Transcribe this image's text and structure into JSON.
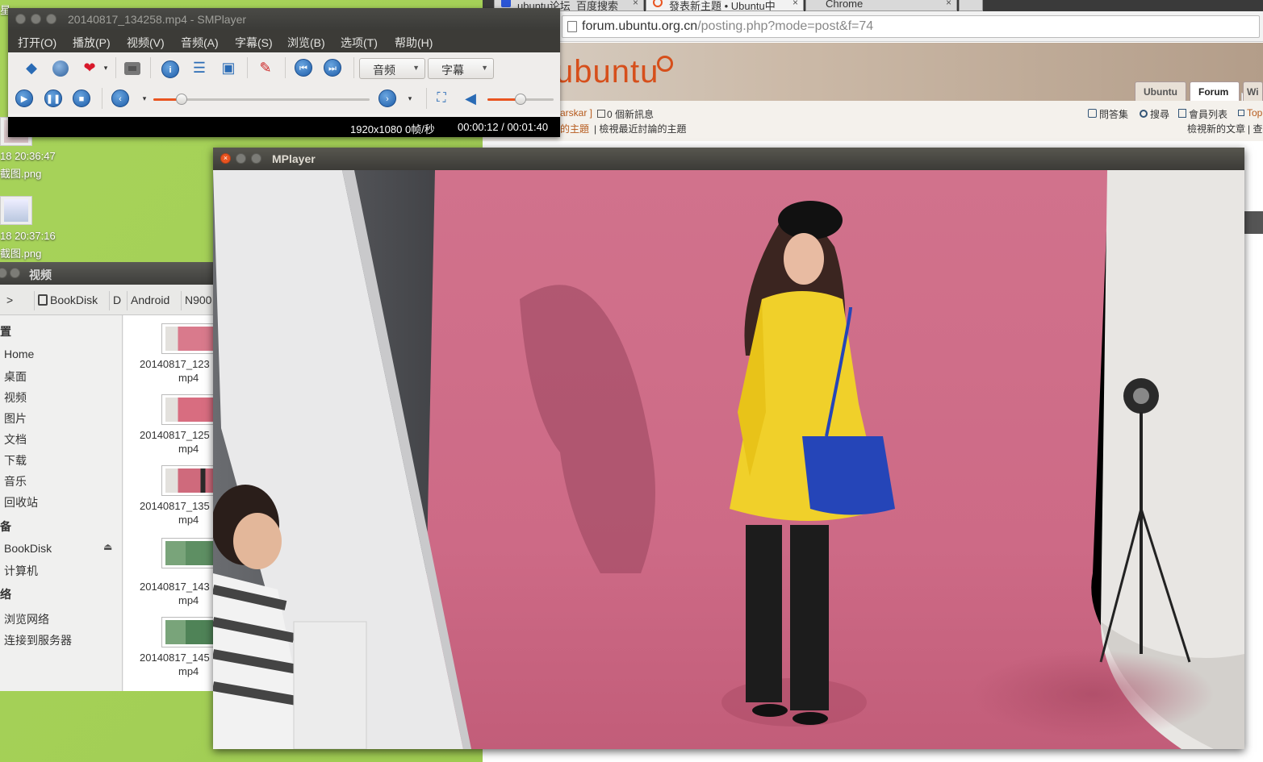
{
  "desktop": {
    "top_left_fragment": "星",
    "files": [
      {
        "time": "18 20:36:47",
        "name": "截图.png"
      },
      {
        "time": "18 20:37:16",
        "name": "截图.png"
      }
    ]
  },
  "chrome": {
    "tabs": [
      {
        "label": "ubuntu论坛_百度搜索",
        "close": "×"
      },
      {
        "label": "發表新主題 • Ubuntu中",
        "close": "×"
      },
      {
        "label": "Chrome",
        "close": "×"
      }
    ],
    "url_host": "forum.ubuntu.org.cn",
    "url_path": "/posting.php?mode=post&f=74",
    "logo": "ubuntu",
    "site_tabs": [
      "Ubuntu",
      "Forum",
      "Wi"
    ],
    "forum_links": {
      "user": "arskar ]",
      "messages": "0 個新訊息",
      "faq": "問答集",
      "search": "搜尋",
      "members": "會員列表",
      "top": "Top",
      "your_topics": "的主題",
      "active_topics": "| 檢視最近討論的主題",
      "new_posts": "檢視新的文章",
      "new_posts_suffix": "| 查"
    }
  },
  "nautilus": {
    "title": "视频",
    "crumbs": [
      "BookDisk",
      "D",
      "Android",
      "N900"
    ],
    "sidebar_top_fragment": "置",
    "sidebar": [
      "Home",
      "桌面",
      "视频",
      "图片",
      "文档",
      "下载",
      "音乐",
      "回收站"
    ],
    "devices_head": "备",
    "devices": [
      "BookDisk",
      "计算机"
    ],
    "network_head": "络",
    "network": [
      "浏览网络",
      "连接到服务器"
    ],
    "files": [
      {
        "name": "20140817_123",
        "ext": "mp4"
      },
      {
        "name": "20140817_125",
        "ext": "mp4"
      },
      {
        "name": "20140817_135",
        "ext": "mp4"
      },
      {
        "name": "20140817_143",
        "ext": "mp4"
      },
      {
        "name": "20140817_145",
        "ext": "mp4"
      }
    ]
  },
  "smplayer": {
    "title": "20140817_134258.mp4 - SMPlayer",
    "menu": [
      "打开(O)",
      "播放(P)",
      "视频(V)",
      "音频(A)",
      "字幕(S)",
      "浏览(B)",
      "选项(T)",
      "帮助(H)"
    ],
    "audio_combo": "音频",
    "subtitle_combo": "字幕",
    "seek_fraction": 0.13,
    "volume_fraction": 0.5,
    "status_resolution": "1920x1080 0帧/秒",
    "status_time": "00:00:12 / 00:01:40"
  },
  "mplayer": {
    "title": "MPlayer"
  }
}
